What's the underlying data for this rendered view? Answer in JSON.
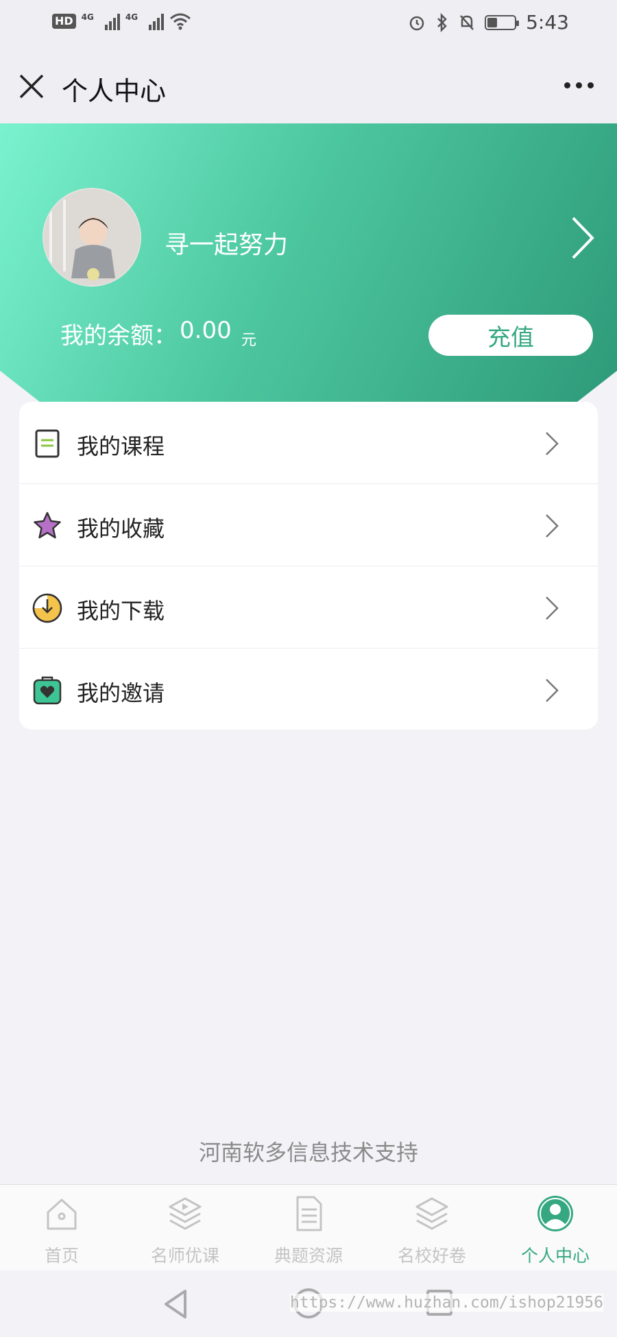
{
  "status_bar": {
    "hd_label": "HD",
    "network_labels": [
      "4G",
      "4G"
    ],
    "time": "5:43"
  },
  "nav": {
    "title": "个人中心"
  },
  "profile": {
    "username": "寻一起努力",
    "balance_label": "我的余额：",
    "balance_value": "0.00",
    "balance_unit": "元",
    "recharge_label": "充值"
  },
  "menu": {
    "items": [
      {
        "label": "我的课程",
        "icon": "course-icon"
      },
      {
        "label": "我的收藏",
        "icon": "star-icon"
      },
      {
        "label": "我的下载",
        "icon": "download-icon"
      },
      {
        "label": "我的邀请",
        "icon": "invite-icon"
      }
    ]
  },
  "footer": {
    "support_text": "河南软多信息技术支持"
  },
  "tabs": [
    {
      "label": "首页",
      "icon": "home-icon",
      "active": false
    },
    {
      "label": "名师优课",
      "icon": "video-layers-icon",
      "active": false
    },
    {
      "label": "典题资源",
      "icon": "document-icon",
      "active": false
    },
    {
      "label": "名校好卷",
      "icon": "layers-icon",
      "active": false
    },
    {
      "label": "个人中心",
      "icon": "user-icon",
      "active": true
    }
  ],
  "watermark": "https://www.huzhan.com/ishop21956",
  "colors": {
    "accent": "#35a882",
    "banner_start": "#7af2cf",
    "banner_end": "#2e9a78",
    "tab_inactive": "#c4c4c4"
  }
}
